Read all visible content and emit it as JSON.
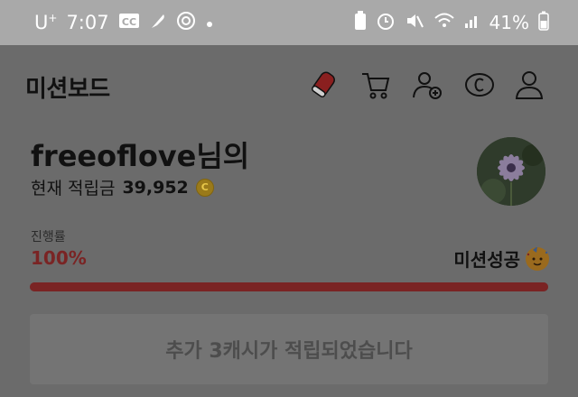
{
  "status_bar": {
    "carrier": "U",
    "carrier_sup": "+",
    "time": "7:07",
    "battery": "41%",
    "icons_left": [
      "cc-icon",
      "feather-icon",
      "settings-ring-icon",
      "dot-icon"
    ],
    "icons_right": [
      "battery-charge-icon",
      "alarm-icon",
      "mute-icon",
      "wifi-icon",
      "signal-icon",
      "battery-icon"
    ]
  },
  "appbar": {
    "title": "미션보드",
    "icons": [
      "shoe-icon",
      "cart-icon",
      "add-friend-icon",
      "cash-icon",
      "user-icon"
    ]
  },
  "profile": {
    "username": "freeoflove",
    "suffix": "님의",
    "points_label": "현재 적립금",
    "points_value": "39,952",
    "coin_symbol": "C"
  },
  "progress": {
    "label": "진행률",
    "value_text": "100%",
    "percent": 100,
    "status": "미션성공",
    "accent_color": "#7a2424"
  },
  "notice": {
    "text": "추가 3캐시가 적립되었습니다"
  }
}
